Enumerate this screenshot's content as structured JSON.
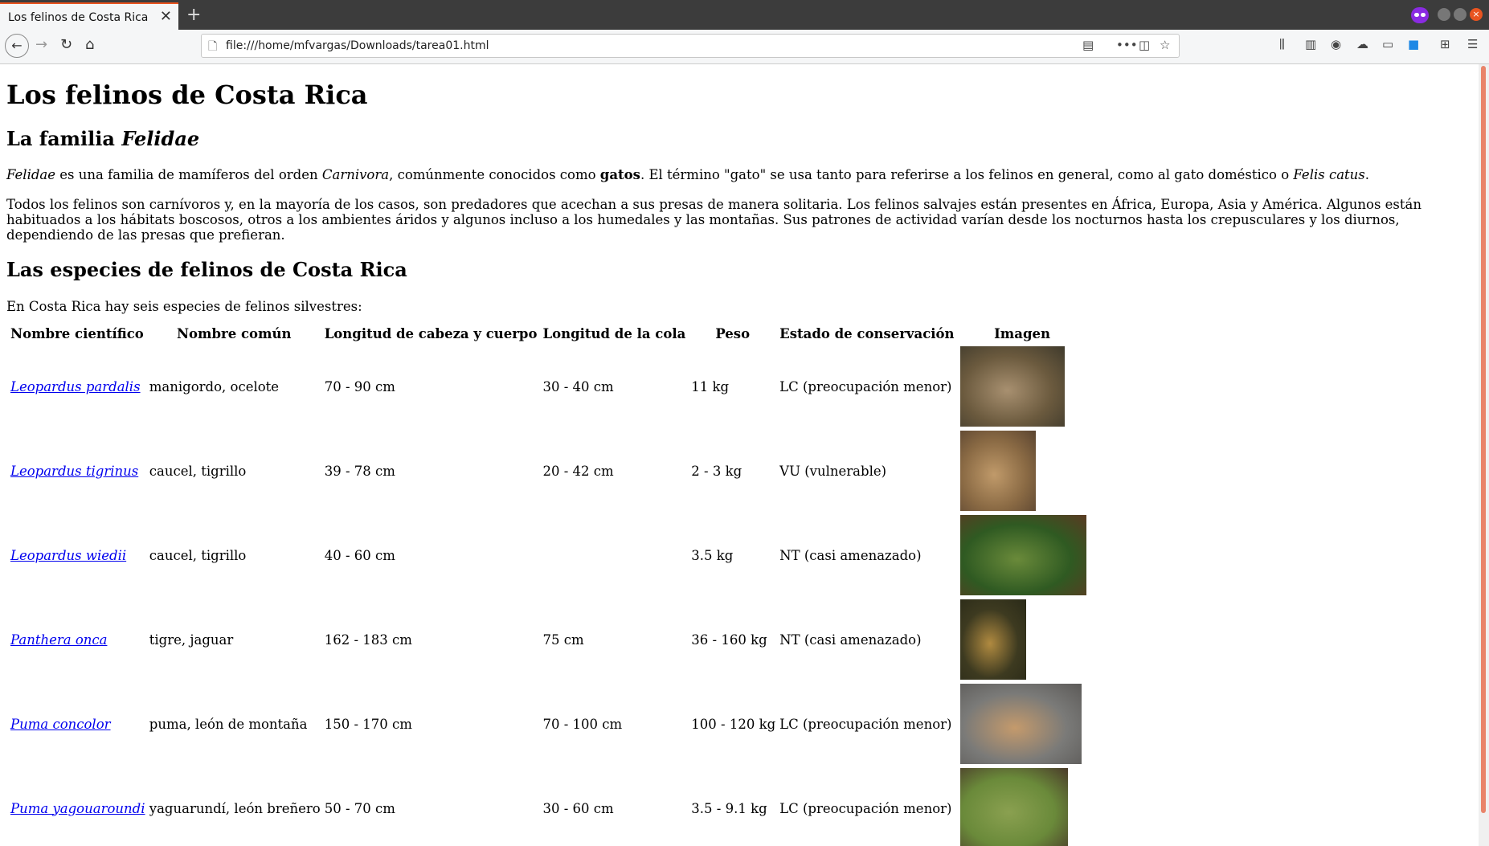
{
  "browser": {
    "tab_title": "Los felinos de Costa Rica",
    "tab_close": "✕",
    "new_tab": "+",
    "url": "file:///home/mfvargas/Downloads/tarea01.html",
    "icons": [
      "back-icon",
      "forward-icon",
      "reload-icon",
      "home-icon",
      "page-info-icon",
      "reader-view-icon",
      "more-icon",
      "pocket-icon",
      "bookmark-star-icon",
      "library-icon",
      "sidebar-icon",
      "account-icon",
      "sync-icon",
      "screenshot-icon",
      "zoom-icon",
      "extensions-icon",
      "menu-icon"
    ]
  },
  "page": {
    "title": "Los felinos de Costa Rica",
    "family_heading_prefix": "La familia ",
    "family_heading_italic": "Felidae",
    "p1": {
      "a": "Felidae",
      "b": " es una familia de mamíferos del orden ",
      "c": "Carnivora",
      "d": ", comúnmente conocidos como ",
      "e": "gatos",
      "f": ". El término \"gato\" se usa tanto para referirse a los felinos en general, como al gato doméstico o ",
      "g": "Felis catus",
      "h": "."
    },
    "p2": "Todos los felinos son carnívoros y, en la mayoría de los casos, son predadores que acechan a sus presas de manera solitaria. Los felinos salvajes están presentes en África, Europa, Asia y América. Algunos están habituados a los hábitats boscosos, otros a los ambientes áridos y algunos incluso a los humedales y las montañas. Sus patrones de actividad varían desde los nocturnos hasta los crepusculares y los diurnos, dependiendo de las presas que prefieran.",
    "species_heading": "Las especies de felinos de Costa Rica",
    "p3": "En Costa Rica hay seis especies de felinos silvestres:",
    "table": {
      "headers": [
        "Nombre científico",
        "Nombre común",
        "Longitud de cabeza y cuerpo",
        "Longitud de la cola",
        "Peso",
        "Estado de conservación",
        "Imagen"
      ],
      "rows": [
        {
          "sci": "Leopardus pardalis",
          "common": "manigordo, ocelote",
          "body": "70 - 90 cm",
          "tail": "30 - 40 cm",
          "weight": "11 kg",
          "status": "LC (preocupación menor)",
          "colors": [
            "#6b5a3e",
            "#a89070",
            "#3f3a2c"
          ]
        },
        {
          "sci": "Leopardus tigrinus",
          "common": "caucel, tigrillo",
          "body": "39 - 78 cm",
          "tail": "20 - 42 cm",
          "weight": "2 - 3 kg",
          "status": "VU (vulnerable)",
          "colors": [
            "#8a6a44",
            "#c09a6a",
            "#5a4430"
          ]
        },
        {
          "sci": "Leopardus wiedii",
          "common": "caucel, tigrillo",
          "body": "40 - 60 cm",
          "tail": "",
          "weight": "3.5 kg",
          "status": "NT (casi amenazado)",
          "colors": [
            "#2f5a22",
            "#6a8a3a",
            "#5a3a22"
          ]
        },
        {
          "sci": "Panthera onca",
          "common": "tigre, jaguar",
          "body": "162 - 183 cm",
          "tail": "75 cm",
          "weight": "36 - 160 kg",
          "status": "NT (casi amenazado)",
          "colors": [
            "#3d3a20",
            "#b08a40",
            "#2a2a18"
          ]
        },
        {
          "sci": "Puma concolor",
          "common": "puma, león de montaña",
          "body": "150 - 170 cm",
          "tail": "70 - 100 cm",
          "weight": "100 - 120 kg",
          "status": "LC (preocupación menor)",
          "colors": [
            "#7a7a78",
            "#c49a6c",
            "#5c5a58"
          ]
        },
        {
          "sci": "Puma yagouaroundi",
          "common": "yaguarundí, león breñero",
          "body": "50 - 70 cm",
          "tail": "30 - 60 cm",
          "weight": "3.5 - 9.1 kg",
          "status": "LC (preocupación menor)",
          "colors": [
            "#6a8a3a",
            "#8aa050",
            "#4a3a2a"
          ]
        }
      ]
    }
  }
}
